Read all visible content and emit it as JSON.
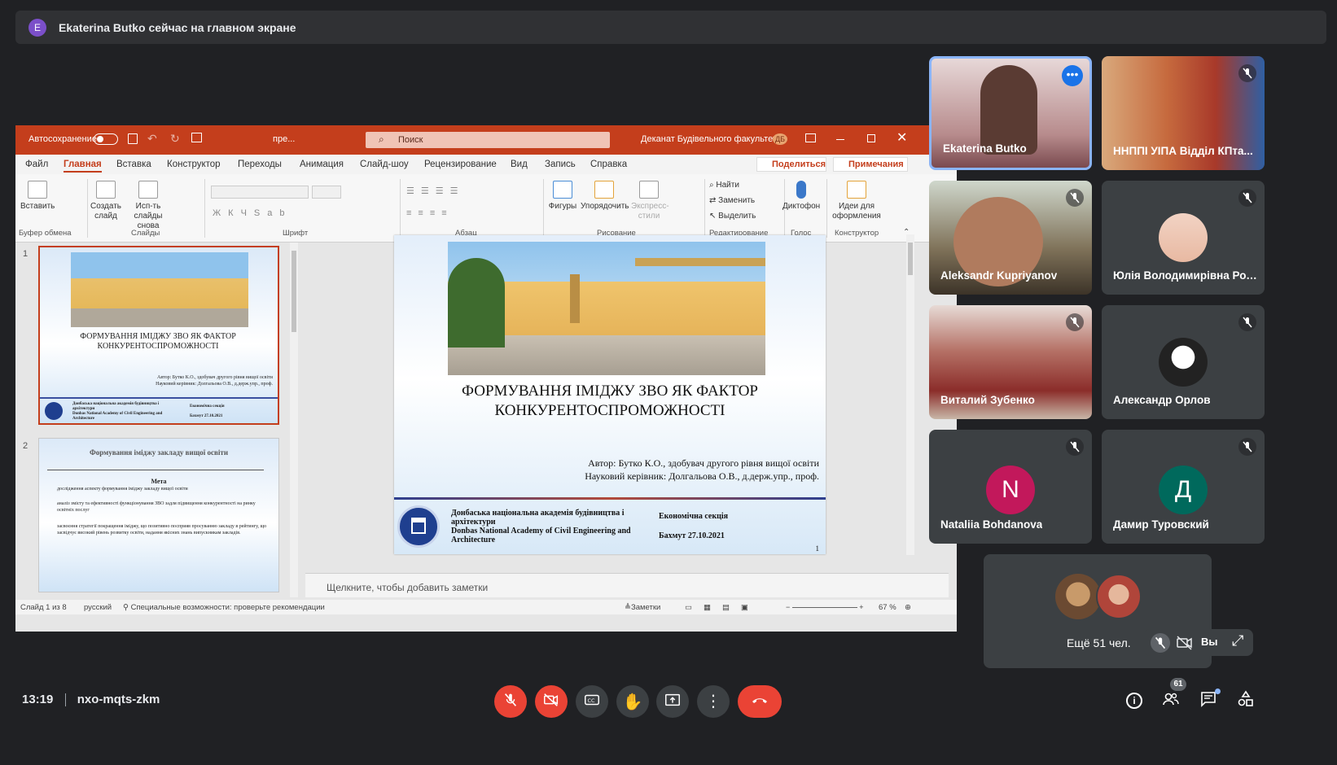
{
  "banner": {
    "avatar_letter": "E",
    "text": "Ekaterina Butko сейчас на главном экране"
  },
  "ppt": {
    "autosave_label": "Автосохранение",
    "file_name": "пре...",
    "search_placeholder": "Поиск",
    "account_name": "Деканат Будівельного факультету",
    "account_initials": "ДБ",
    "menu": [
      "Файл",
      "Главная",
      "Вставка",
      "Конструктор",
      "Переходы",
      "Анимация",
      "Слайд-шоу",
      "Рецензирование",
      "Вид",
      "Запись",
      "Справка"
    ],
    "share_label": "Поделиться",
    "comments_label": "Примечания",
    "ribbon": {
      "paste": "Вставить",
      "clipboard": "Буфер обмена",
      "new_slide": "Создать слайд",
      "reuse": "Исп-ть слайды снова",
      "slides": "Слайды",
      "font": "Шрифт",
      "paragraph": "Абзац",
      "shapes": "Фигуры",
      "arrange": "Упорядочить",
      "quick_styles": "Экспресс-стили",
      "drawing": "Рисование",
      "find": "Найти",
      "replace": "Заменить",
      "select": "Выделить",
      "editing": "Редактирование",
      "dictate": "Диктофон",
      "voice": "Голос",
      "designer_ideas": "Идеи для оформления",
      "designer": "Конструктор"
    },
    "thumb1": {
      "num": "1",
      "title": "ФОРМУВАННЯ ІМІДЖУ ЗВО ЯК ФАКТОР КОНКУРЕНТОСПРОМОЖНОСТІ",
      "author": "Автор: Бутко К.О., здобувач другого рівня вищої освіти",
      "supervisor": "Науковий керівник: Долгальова О.В., д.держ.упр., проф.",
      "academy": "Донбаська національна академія будівництва і архітектури",
      "academy_en": "Donbas National Academy of Civil Engineering and Architecture",
      "section": "Економічна секція",
      "date": "Бахмут 27.10.2021"
    },
    "thumb2": {
      "num": "2",
      "title": "Формування іміджу закладу вищої освіти",
      "goal": "Мета",
      "items": [
        "дослідження аспекту формування іміджу закладу вищої освіти",
        "аналіз змісту та ефективності функціонування ЗВО задля підвищення конкурентності на ринку освітніх послуг",
        "засвоєння стратегії покращення іміджу, що позитивно посприяв просуванню закладу в рейтингу, що засвідчує високий рівень розвитку освіти, надання якісних знань випускникам закладів."
      ]
    },
    "slide": {
      "title_line1": "ФОРМУВАННЯ ІМІДЖУ ЗВО ЯК ФАКТОР",
      "title_line2": "КОНКУРЕНТОСПРОМОЖНОСТІ",
      "author": "Автор: Бутко К.О., здобувач другого рівня вищої освіти",
      "supervisor": "Науковий керівник: Долгальова О.В., д.держ.упр., проф.",
      "academy": "Донбаська національна академія будівництва і архітектури",
      "academy_en": "Donbas National Academy of Civil Engineering and Architecture",
      "section": "Економічна секція",
      "date": "Бахмут 27.10.2021",
      "page": "1"
    },
    "notes_placeholder": "Щелкните, чтобы добавить заметки",
    "status": {
      "slide_of": "Слайд 1 из 8",
      "language": "русский",
      "accessibility": "Специальные возможности: проверьте рекомендации",
      "notes_btn": "Заметки",
      "zoom": "67 %"
    }
  },
  "participants": [
    {
      "name": "Ekaterina Butko"
    },
    {
      "name": "ННППІ УІПА Відділ КПта..."
    },
    {
      "name": "Aleksandr Kupriyanov"
    },
    {
      "name": "Юлія Володимирівна Ром..."
    },
    {
      "name": "Виталий Зубенко"
    },
    {
      "name": "Александр Орлов"
    },
    {
      "name": "Nataliia Bohdanova",
      "initial": "N"
    },
    {
      "name": "Дамир Туровский",
      "initial": "Д"
    }
  ],
  "overflow": {
    "more_label": "Ещё 51 чел.",
    "you_label": "Вы"
  },
  "bottom": {
    "time": "13:19",
    "meeting_code": "nxo-mqts-zkm",
    "people_count": "61"
  },
  "colors": {
    "accent_red": "#ea4335",
    "ppt_red": "#c43e1c",
    "nataliia": "#c2185b",
    "damir": "#00695c",
    "speaker_border": "#8ab4f8"
  },
  "icons": [
    "mic-off-icon",
    "camera-off-icon",
    "captions-icon",
    "raise-hand-icon",
    "present-icon",
    "more-vert-icon",
    "hangup-icon",
    "info-icon",
    "people-icon",
    "chat-icon",
    "activities-icon"
  ]
}
